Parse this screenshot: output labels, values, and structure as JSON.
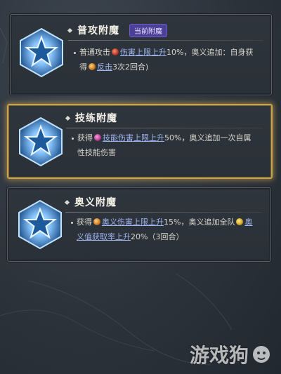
{
  "cards": [
    {
      "title": "普攻附魔",
      "badge": "当前附魔",
      "line1_a": "普通攻击",
      "line1_b": "伤害上限上升",
      "line1_c": "10%，奥义追加：自身获",
      "line2_a": "得",
      "line2_b": "反击",
      "line2_c": "3次2回合)"
    },
    {
      "title": "技练附魔",
      "line1_a": "获得",
      "line1_b": "技能伤害上限上升",
      "line1_c": "50%，奥义追加一次自属",
      "line2_a": "性技能伤害"
    },
    {
      "title": "奥义附魔",
      "line1_a": "获得",
      "line1_b": "奥义伤害上限上升",
      "line1_c": "15%，奥义追加全队",
      "line1_d": "奥",
      "line2_a": "义值获取率上升",
      "line2_b": "20%（3回合）"
    }
  ],
  "watermark": "游戏狗",
  "colors": {
    "selected_border": "#c9a24c",
    "badge": "#4b3f97",
    "highlight": "#9fb4f0"
  }
}
